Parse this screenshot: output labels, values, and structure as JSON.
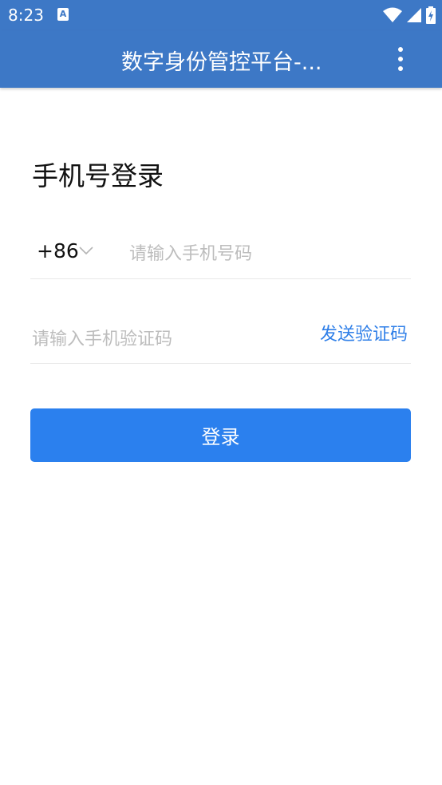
{
  "status_bar": {
    "time": "8:23",
    "notification_icon": "a-letter-icon",
    "wifi_icon": "wifi-icon",
    "signal_icon": "cell-signal-icon",
    "battery_icon": "battery-charging-icon"
  },
  "app_bar": {
    "title": "数字身份管控平台-...",
    "menu_icon": "more-vert-icon"
  },
  "login": {
    "heading": "手机号登录",
    "country_code": "+86",
    "country_code_icon": "chevron-down-icon",
    "phone_placeholder": "请输入手机号码",
    "phone_value": "",
    "code_placeholder": "请输入手机验证码",
    "code_value": "",
    "send_code_label": "发送验证码",
    "submit_label": "登录"
  },
  "colors": {
    "app_bar": "#3d78c6",
    "primary_button": "#2b80ee",
    "link": "#2f7fe8",
    "placeholder": "#bdbdbd",
    "divider": "#e8e8e8"
  }
}
